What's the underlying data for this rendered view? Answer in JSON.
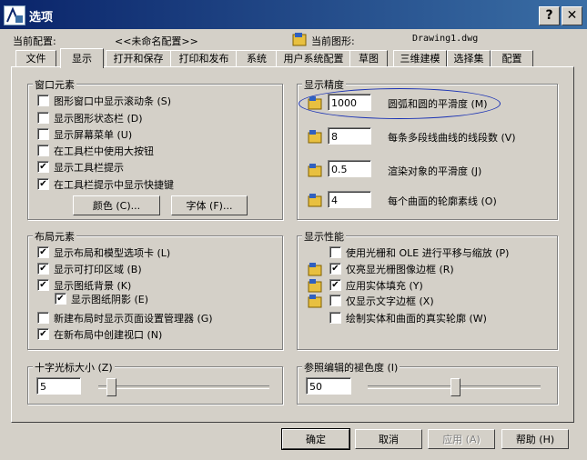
{
  "window": {
    "title": "选项",
    "help_glyph": "?",
    "close_glyph": "✕"
  },
  "header": {
    "profile_label": "当前配置:",
    "profile_value": "<<未命名配置>>",
    "drawing_label": "当前图形:",
    "drawing_value": "Drawing1.dwg"
  },
  "tabs": [
    "文件",
    "显示",
    "打开和保存",
    "打印和发布",
    "系统",
    "用户系统配置",
    "草图",
    "三维建模",
    "选择集",
    "配置"
  ],
  "active_tab": "显示",
  "window_elements": {
    "title": "窗口元素",
    "items": [
      {
        "label": "图形窗口中显示滚动条 (S)",
        "checked": false
      },
      {
        "label": "显示图形状态栏 (D)",
        "checked": false
      },
      {
        "label": "显示屏幕菜单 (U)",
        "checked": false
      },
      {
        "label": "在工具栏中使用大按钮",
        "checked": false
      },
      {
        "label": "显示工具栏提示",
        "checked": true
      },
      {
        "label": "在工具栏提示中显示快捷键",
        "checked": true
      }
    ],
    "colors_button": "颜色 (C)...",
    "fonts_button": "字体 (F)..."
  },
  "display_resolution": {
    "title": "显示精度",
    "items": [
      {
        "value": "1000",
        "label": "圆弧和圆的平滑度 (M)"
      },
      {
        "value": "8",
        "label": "每条多段线曲线的线段数 (V)"
      },
      {
        "value": "0.5",
        "label": "渲染对象的平滑度 (J)"
      },
      {
        "value": "4",
        "label": "每个曲面的轮廓素线 (O)"
      }
    ]
  },
  "layout_elements": {
    "title": "布局元素",
    "items": [
      {
        "label": "显示布局和模型选项卡 (L)",
        "checked": true
      },
      {
        "label": "显示可打印区域 (B)",
        "checked": true
      },
      {
        "label": "显示图纸背景 (K)",
        "checked": true
      },
      {
        "label": "显示图纸阴影 (E)",
        "checked": true
      },
      {
        "label": "新建布局时显示页面设置管理器 (G)",
        "checked": false
      },
      {
        "label": "在新布局中创建视口 (N)",
        "checked": true
      }
    ]
  },
  "display_performance": {
    "title": "显示性能",
    "items": [
      {
        "label": "使用光栅和 OLE 进行平移与缩放 (P)",
        "checked": false
      },
      {
        "label": "仅亮显光栅图像边框 (R)",
        "checked": true
      },
      {
        "label": "应用实体填充 (Y)",
        "checked": true
      },
      {
        "label": "仅显示文字边框 (X)",
        "checked": false
      },
      {
        "label": "绘制实体和曲面的真实轮廓 (W)",
        "checked": false
      }
    ]
  },
  "crosshair": {
    "title": "十字光标大小 (Z)",
    "value": "5",
    "level_percent": 5
  },
  "xref_fade": {
    "title": "参照编辑的褪色度 (I)",
    "value": "50",
    "level_percent": 50
  },
  "buttons": {
    "ok": "确定",
    "cancel": "取消",
    "apply": "应用 (A)",
    "help": "帮助 (H)"
  },
  "check_glyph": "✔"
}
